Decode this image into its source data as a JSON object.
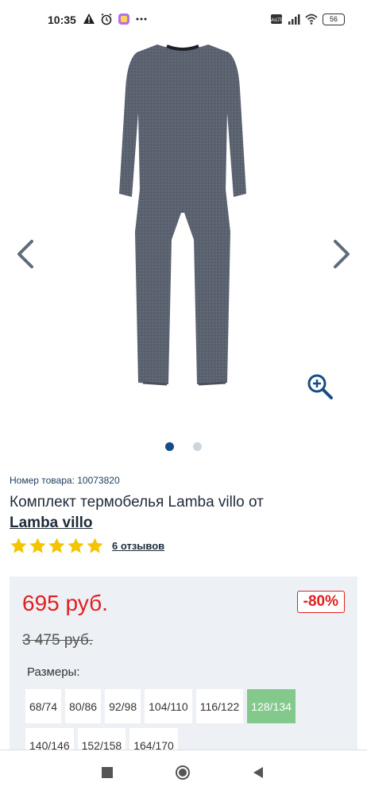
{
  "status_bar": {
    "time": "10:35",
    "battery": "56",
    "icons": [
      "warning-icon",
      "alarm-icon",
      "app-icon",
      "more-icon",
      "volte-icon",
      "signal-icon",
      "wifi-icon",
      "battery-icon"
    ]
  },
  "gallery": {
    "image": "thermal-underwear-set-image",
    "slide_count": 2,
    "active_slide": 1
  },
  "product": {
    "sku_label": "Номер товара: 10073820",
    "title_prefix": "Комплект термобелья Lamba villo от",
    "brand": "Lamba villo",
    "rating_stars": 5,
    "reviews": "6 отзывов"
  },
  "pricing": {
    "price": "695 руб.",
    "old_price": "3 475 руб.",
    "discount": "-80%",
    "sizes_label": "Размеры:",
    "sizes": [
      "68/74",
      "80/86",
      "92/98",
      "104/110",
      "116/122",
      "128/134",
      "140/146",
      "152/158",
      "164/170"
    ],
    "selected_size": "128/134"
  },
  "colors": {
    "accent": "#154c86",
    "price_red": "#e02020",
    "selected_size": "#84c98c",
    "star": "#f5c400"
  }
}
